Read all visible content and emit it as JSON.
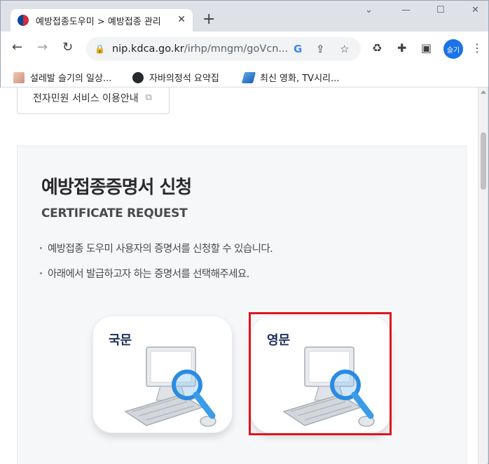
{
  "browser": {
    "tab_title": "예방접종도우미 > 예방접종 관리",
    "tab_close": "✕",
    "new_tab": "+",
    "window_controls": {
      "minimize": "—",
      "restore": "☐",
      "close": "✕",
      "dropdown": "⌄"
    },
    "nav": {
      "back": "←",
      "forward": "→",
      "reload": "↻"
    },
    "url_host": "nip.kdca.go.kr",
    "url_path": "/irhp/mngm/goVcn...",
    "profile_label": "슬기",
    "bookmarks": [
      {
        "label": "설레발 슬기의 일상..."
      },
      {
        "label": "자바의정석 요약집"
      },
      {
        "label": "최신 영화, TV시리..."
      }
    ]
  },
  "page": {
    "info_button_label": "전자민원 서비스 이용안내",
    "section_title": "예방접종증명서 신청",
    "section_subtitle": "CERTIFICATE REQUEST",
    "bullets": [
      "예방접종 도우미 사용자의 증명서를 신청할 수 있습니다.",
      "아래에서 발급하고자 하는 증명서를 선택해주세요."
    ],
    "cards": [
      {
        "label": "국문"
      },
      {
        "label": "영문"
      }
    ]
  },
  "colors": {
    "highlight": "#e0141e",
    "card_title": "#1e2f5a",
    "panel_bg": "#f6f7f9",
    "profile": "#1a73e8"
  }
}
